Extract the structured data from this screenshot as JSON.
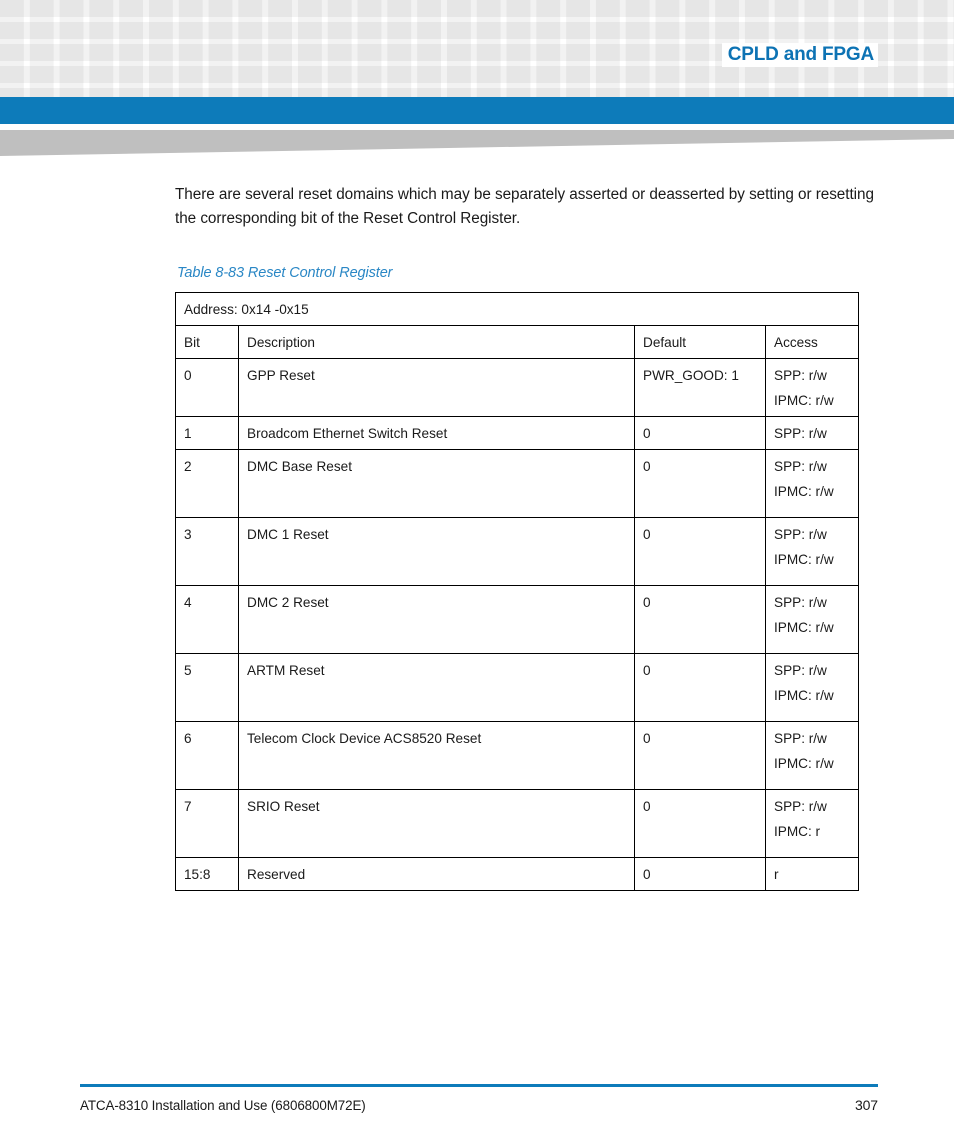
{
  "header": {
    "title": "CPLD and FPGA",
    "accent_color": "#0d7bba",
    "title_color": "#0d73b4",
    "swoosh_color": "#bfbfbf",
    "checker_color": "#f2f2f2"
  },
  "body": {
    "intro_paragraph": "There are several reset domains which may be separately asserted or deasserted by setting or resetting the corresponding bit of the Reset Control Register.",
    "table_caption": "Table 8-83 Reset Control Register",
    "caption_color": "#2a87c5"
  },
  "table": {
    "address_label": "Address: 0x14 -0x15",
    "columns": [
      "Bit",
      "Description",
      "Default",
      "Access"
    ],
    "rows": [
      {
        "bit": "0",
        "description": "GPP Reset",
        "default": "PWR_GOOD: 1",
        "access": [
          "SPP: r/w",
          "IPMC: r/w"
        ]
      },
      {
        "bit": "1",
        "description": "Broadcom Ethernet Switch Reset",
        "default": "0",
        "access": [
          "SPP: r/w"
        ]
      },
      {
        "bit": "2",
        "description": "DMC Base Reset",
        "default": "0",
        "access": [
          "SPP: r/w",
          "IPMC: r/w"
        ]
      },
      {
        "bit": "3",
        "description": "DMC 1 Reset",
        "default": "0",
        "access": [
          "SPP: r/w",
          "IPMC: r/w"
        ]
      },
      {
        "bit": "4",
        "description": "DMC 2 Reset",
        "default": "0",
        "access": [
          "SPP: r/w",
          "IPMC: r/w"
        ]
      },
      {
        "bit": "5",
        "description": "ARTM Reset",
        "default": "0",
        "access": [
          "SPP: r/w",
          "IPMC: r/w"
        ]
      },
      {
        "bit": "6",
        "description": "Telecom Clock Device ACS8520 Reset",
        "default": "0",
        "access": [
          "SPP: r/w",
          "IPMC: r/w"
        ]
      },
      {
        "bit": "7",
        "description": "SRIO Reset",
        "default": "0",
        "access": [
          "SPP: r/w",
          "IPMC: r"
        ]
      },
      {
        "bit": "15:8",
        "description": "Reserved",
        "default": "0",
        "access": [
          "r"
        ]
      }
    ]
  },
  "footer": {
    "document_title": "ATCA-8310 Installation and Use (6806800M72E)",
    "page_number": "307",
    "rule_color": "#0d7bba"
  }
}
